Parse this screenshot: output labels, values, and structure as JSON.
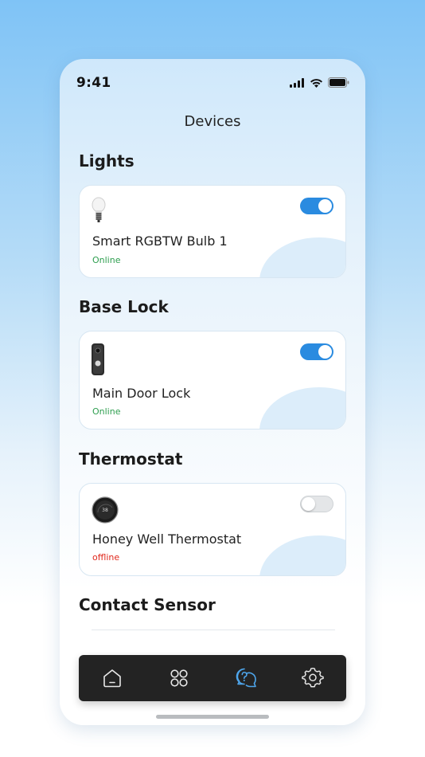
{
  "status_bar": {
    "time": "9:41"
  },
  "header": {
    "title": "Devices"
  },
  "sections": [
    {
      "title": "Lights",
      "device": {
        "name": "Smart RGBTW Bulb 1",
        "status": "Online",
        "enabled": true,
        "icon": "bulb-icon"
      }
    },
    {
      "title": "Base Lock",
      "device": {
        "name": "Main Door Lock",
        "status": "Online",
        "enabled": true,
        "icon": "door-lock-icon"
      }
    },
    {
      "title": "Thermostat",
      "device": {
        "name": "Honey Well Thermostat",
        "status": "offline",
        "enabled": false,
        "icon": "thermostat-icon"
      }
    },
    {
      "title": "Contact Sensor"
    }
  ],
  "nav": [
    {
      "icon": "home-icon",
      "active": false
    },
    {
      "icon": "grid-icon",
      "active": false
    },
    {
      "icon": "help-chat-icon",
      "active": true
    },
    {
      "icon": "gear-icon",
      "active": false
    }
  ],
  "colors": {
    "accent": "#2a8be0",
    "online": "#2e9e4f",
    "offline": "#e0281c",
    "nav_bg": "#232323"
  }
}
